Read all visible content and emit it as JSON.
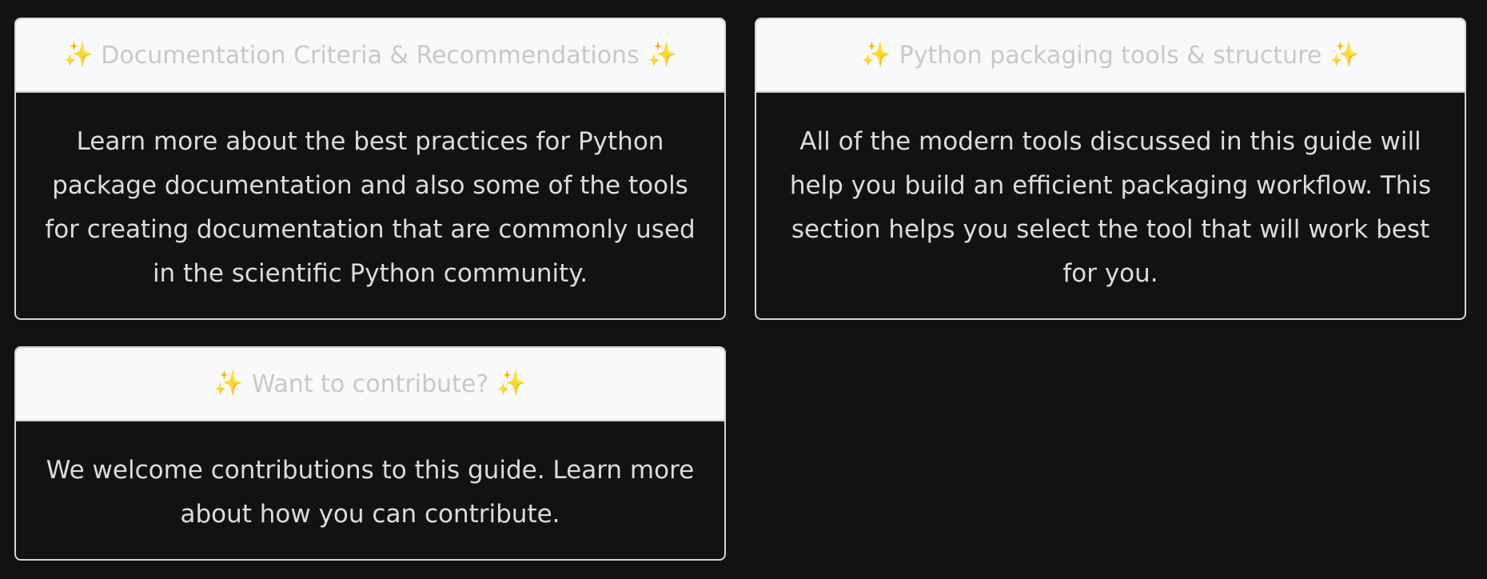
{
  "cards": [
    {
      "title": "Documentation Criteria & Recommendations",
      "body": "Learn more about the best practices for Python package documentation and also some of the tools for creating documentation that are commonly used in the scientific Python community."
    },
    {
      "title": "Python packaging tools & structure",
      "body": "All of the modern tools discussed in this guide will help you build an efficient packaging workflow. This section helps you select the tool that will work best for you."
    },
    {
      "title": "Want to contribute?",
      "body": "We welcome contributions to this guide. Learn more about how you can contribute."
    }
  ],
  "icons": {
    "sparkle": "sparkles-icon",
    "sparkle_glyph": "✨"
  },
  "colors": {
    "page_background": "#121212",
    "card_header_background": "#f8f9fb",
    "card_border": "#d6d6d6",
    "header_text": "#c8c8c8",
    "body_text": "#dcdcdc",
    "sparkle": "#f1c21b"
  }
}
